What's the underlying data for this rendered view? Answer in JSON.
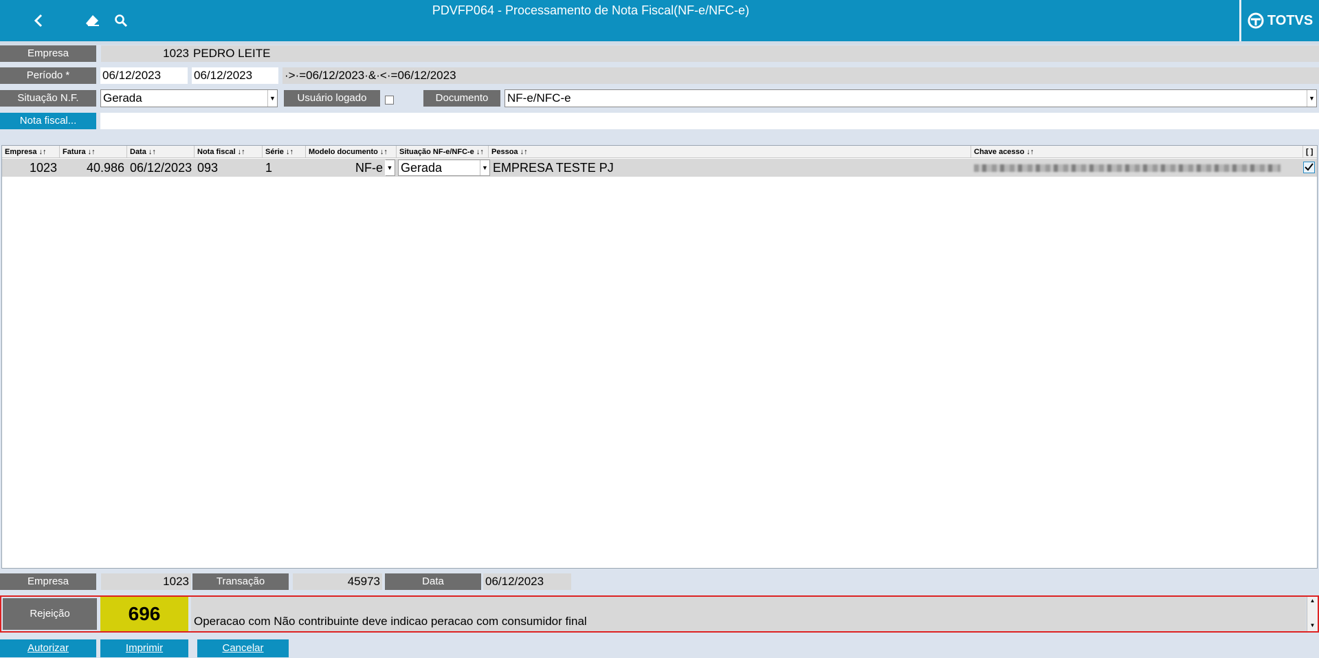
{
  "window": {
    "title": "PDVFP064 - Processamento de Nota Fiscal(NF-e/NFC-e)",
    "logo_text": "TOTVS"
  },
  "icons": {
    "back": "chevron-left-icon",
    "clear": "eraser-icon",
    "search": "search-icon"
  },
  "filters": {
    "empresa_label": "Empresa",
    "empresa_code": "1023",
    "empresa_name": "PEDRO LEITE",
    "periodo_label": "Período *",
    "periodo_start": "06/12/2023",
    "periodo_end": "06/12/2023",
    "periodo_expr": "·>·=06/12/2023·&·<·=06/12/2023",
    "situacao_label": "Situação N.F.",
    "situacao_value": "Gerada",
    "usuario_label": "Usuário logado",
    "documento_label": "Documento",
    "documento_value": "NF-e/NFC-e",
    "nota_label": "Nota fiscal...",
    "nota_value": ""
  },
  "grid": {
    "columns": [
      "Empresa ↓↑",
      "Fatura ↓↑",
      "Data ↓↑",
      "Nota fiscal ↓↑",
      "Série ↓↑",
      "Modelo documento ↓↑",
      "Situação NF-e/NFC-e ↓↑",
      "Pessoa ↓↑",
      "Chave acesso ↓↑",
      "[ ]"
    ],
    "rows": [
      {
        "empresa": "1023",
        "fatura": "40.986",
        "data": "06/12/2023",
        "nota_fiscal": "093",
        "serie": "1",
        "modelo": "NF-e",
        "situacao": "Gerada",
        "pessoa": "EMPRESA TESTE PJ",
        "checked": true
      }
    ]
  },
  "footer": {
    "empresa_label": "Empresa",
    "empresa_value": "1023",
    "transacao_label": "Transação",
    "transacao_value": "45973",
    "data_label": "Data",
    "data_value": "06/12/2023",
    "rejeicao_label": "Rejeição",
    "rejeicao_code": "696",
    "rejeicao_msg": "Operacao com Não contribuinte deve indicao peracao com consumidor final"
  },
  "actions": {
    "autorizar": "Autorizar",
    "imprimir": "Imprimir",
    "cancelar": "Cancelar"
  },
  "colors": {
    "brand_blue": "#0d90c0",
    "label_gray": "#6d6d6d",
    "rejection_code_bg": "#d4cf0a",
    "rejection_border": "#dd2222"
  }
}
